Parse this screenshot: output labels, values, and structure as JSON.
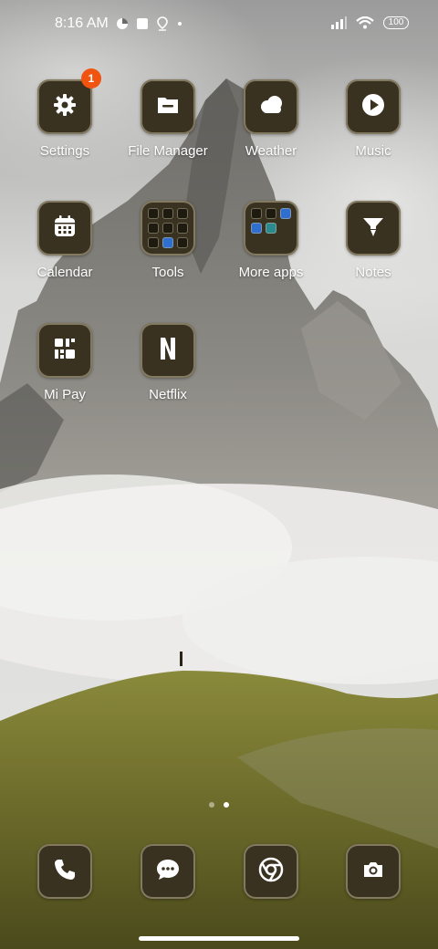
{
  "status_bar": {
    "time": "8:16 AM",
    "battery": "100",
    "icons": [
      "data-saver-icon",
      "square-notification-icon",
      "location-pin-icon",
      "signal-icon",
      "wifi-icon",
      "battery-icon"
    ]
  },
  "apps": [
    {
      "label": "Settings",
      "icon": "gear-icon",
      "badge": "1"
    },
    {
      "label": "File Manager",
      "icon": "folder-icon"
    },
    {
      "label": "Weather",
      "icon": "cloud-icon"
    },
    {
      "label": "Music",
      "icon": "play-circle-icon"
    },
    {
      "label": "Calendar",
      "icon": "calendar-icon"
    },
    {
      "label": "Tools",
      "icon": "folder-grid-icon"
    },
    {
      "label": "More apps",
      "icon": "folder-grid-icon"
    },
    {
      "label": "Notes",
      "icon": "notes-icon"
    },
    {
      "label": "Mi Pay",
      "icon": "mi-pay-icon"
    },
    {
      "label": "Netflix",
      "icon": "netflix-icon"
    }
  ],
  "dock": [
    {
      "name": "phone",
      "icon": "phone-icon"
    },
    {
      "name": "messages",
      "icon": "chat-bubble-icon"
    },
    {
      "name": "chrome",
      "icon": "chrome-icon"
    },
    {
      "name": "camera",
      "icon": "camera-icon"
    }
  ],
  "page_indicator": {
    "pages": 2,
    "current": 2
  },
  "colors": {
    "tile_bg": "#3a3220",
    "badge": "#f0540f"
  }
}
